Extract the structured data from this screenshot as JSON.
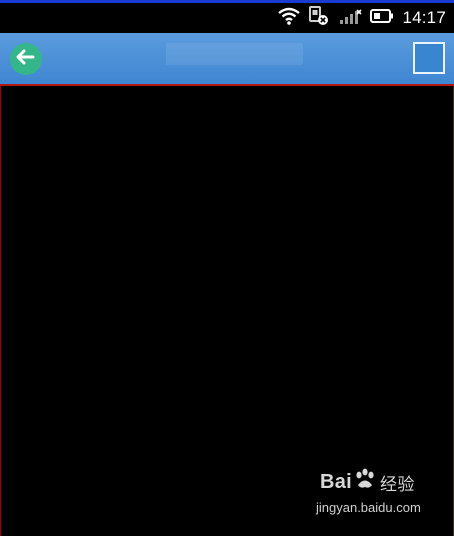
{
  "status_bar": {
    "time": "14:17",
    "icons": [
      "wifi-icon",
      "sim-error-icon",
      "signal-icon",
      "battery-icon"
    ]
  },
  "title_bar": {
    "title": "",
    "back_icon": "arrow-left-icon",
    "action_icon": "square-icon",
    "colors": {
      "bar": "#4a8fd6",
      "back_button": "#34b58a",
      "underline": "#b21616"
    }
  },
  "watermark": {
    "brand_left": "Bai",
    "brand_right": "经验",
    "url": "jingyan.baidu.com"
  }
}
